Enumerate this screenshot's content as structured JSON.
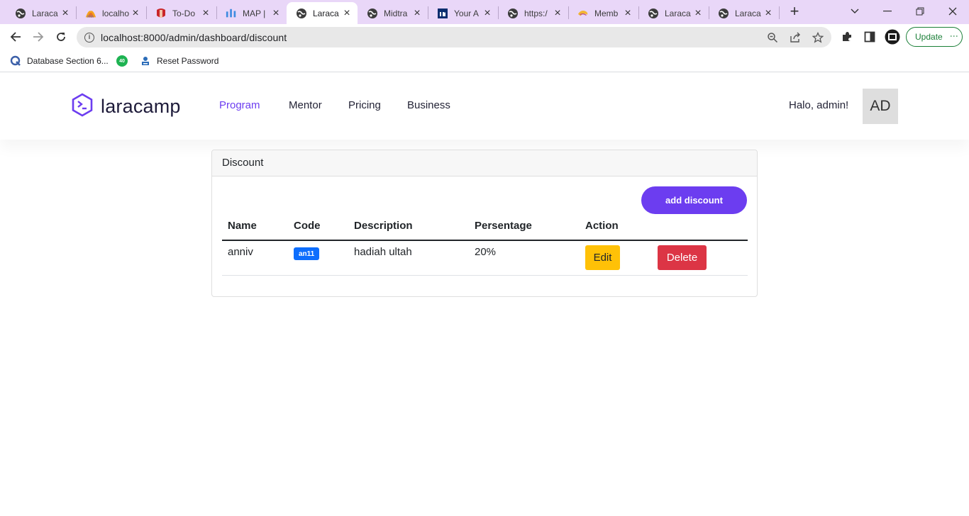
{
  "browser": {
    "tabs": [
      {
        "title": "Laraca",
        "icon": "globe-icon"
      },
      {
        "title": "localho",
        "icon": "phpmyadmin-icon"
      },
      {
        "title": "To-Do",
        "icon": "todo-app-icon"
      },
      {
        "title": "MAP |",
        "icon": "map-chart-icon"
      },
      {
        "title": "Laraca",
        "icon": "globe-icon",
        "active": true
      },
      {
        "title": "Midtra",
        "icon": "globe-icon"
      },
      {
        "title": "Your A",
        "icon": "linkedin-style-icon"
      },
      {
        "title": "https:/",
        "icon": "globe-icon"
      },
      {
        "title": "Memb",
        "icon": "member-app-icon"
      },
      {
        "title": "Laraca",
        "icon": "globe-icon"
      },
      {
        "title": "Laraca",
        "icon": "globe-icon"
      }
    ],
    "url": "localhost:8000/admin/dashboard/discount",
    "update_label": "Update",
    "bookmarks": [
      {
        "label": "Database Section 6...",
        "icon": "q-logo-icon"
      },
      {
        "label": "",
        "icon": "badge-40-icon",
        "badge": "40"
      },
      {
        "label": "Reset Password",
        "icon": "site-icon"
      }
    ]
  },
  "site": {
    "logo_text": "laracamp",
    "nav": [
      {
        "label": "Program",
        "active": true
      },
      {
        "label": "Mentor"
      },
      {
        "label": "Pricing"
      },
      {
        "label": "Business"
      }
    ],
    "greeting": "Halo, admin!",
    "avatar_initials": "AD"
  },
  "discount_card": {
    "title": "Discount",
    "add_button": "add discount",
    "columns": [
      "Name",
      "Code",
      "Description",
      "Persentage",
      "Action"
    ],
    "rows": [
      {
        "name": "anniv",
        "code": "an11",
        "description": "hadiah ultah",
        "percentage": "20%",
        "edit": "Edit",
        "delete": "Delete"
      }
    ]
  },
  "colors": {
    "accent": "#6c3df0",
    "tab_strip": "#e9d7f8",
    "badge": "#0d6efd",
    "edit": "#ffc107",
    "delete": "#dc3545"
  }
}
